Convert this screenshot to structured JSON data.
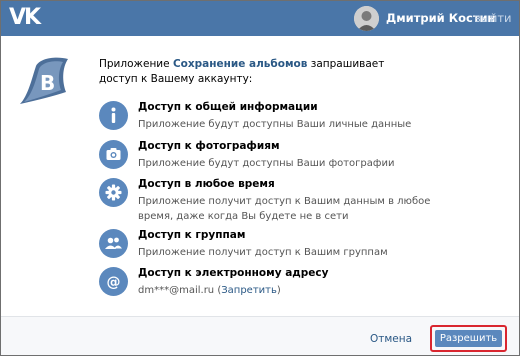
{
  "header": {
    "logo_text": "VK",
    "user_name": "Дмитрий Костин",
    "logout_label": "выйти"
  },
  "intro": {
    "before": "Приложение ",
    "app_name": "Сохранение альбомов",
    "after": " запрашивает доступ к Вашему аккаунту:"
  },
  "permissions": [
    {
      "icon": "info-icon",
      "title": "Доступ к общей информации",
      "description": "Приложение будут доступны Ваши личные данные"
    },
    {
      "icon": "camera-icon",
      "title": "Доступ к фотографиям",
      "description": "Приложение будут доступны Ваши фотографии"
    },
    {
      "icon": "gear-icon",
      "title": "Доступ в любое время",
      "description": "Приложение получит доступ к Вашим данным в любое время, даже когда Вы будете не в сети"
    },
    {
      "icon": "people-icon",
      "title": "Доступ к группам",
      "description": "Приложение получит доступ к Вашим группам"
    },
    {
      "icon": "at-icon",
      "title": "Доступ к электронному адресу",
      "description": "dm***@mail.ru",
      "action_open": " (",
      "action_label": "Запретить",
      "action_close": ")"
    }
  ],
  "footer": {
    "cancel_label": "Отмена",
    "allow_label": "Разрешить"
  },
  "colors": {
    "header": "#4a76a8",
    "accent": "#5b88bd",
    "link": "#2a5885",
    "highlight_border": "#d9262f"
  }
}
